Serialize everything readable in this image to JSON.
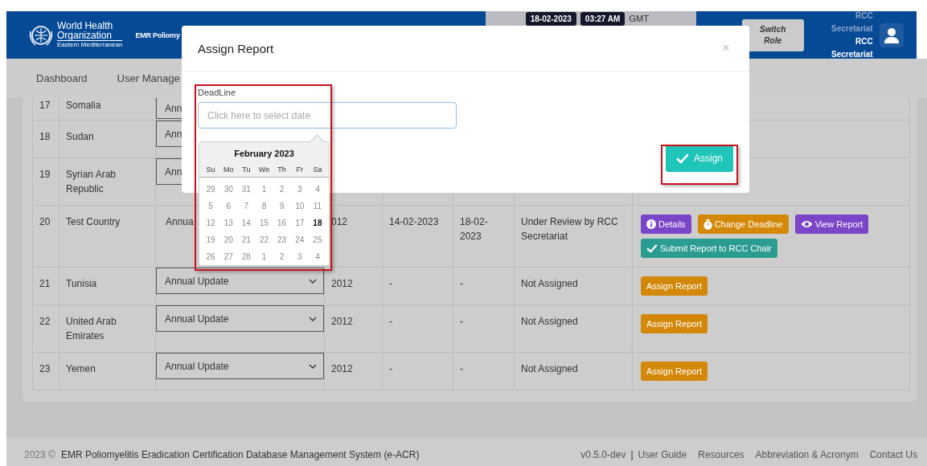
{
  "header": {
    "org_name": "World Health",
    "org_name_2": "Organization",
    "org_region": "Eastern Mediterranean",
    "app_title": "EMR Poliomy",
    "date": "18-02-2023",
    "time": "03:27 AM",
    "timezone": "GMT",
    "switch_role": "Switch Role",
    "user_role_faded": "RCC Secretariat",
    "user_role": "RCC Secretariat"
  },
  "nav": [
    "Dashboard",
    "User Manage"
  ],
  "rows": [
    {
      "no": "17",
      "country": "Somalia",
      "type": {
        "kind": "select",
        "value": "Ann"
      }
    },
    {
      "no": "18",
      "country": "Sudan",
      "type": {
        "kind": "select",
        "value": "Ann"
      }
    },
    {
      "no": "19",
      "country": "Syrian Arab Republic",
      "type": {
        "kind": "select",
        "value": "Ann"
      }
    },
    {
      "no": "20",
      "country": "Test Country",
      "type": {
        "kind": "text",
        "value": "Annua"
      },
      "year": "012",
      "assigned": "14-02-2023",
      "deadline": "18-02-2023",
      "status": "Under Review by RCC Secretariat",
      "actions": [
        {
          "label": "Details",
          "kind": "details"
        },
        {
          "label": "Change Deadline",
          "kind": "deadline"
        },
        {
          "label": "View Report",
          "kind": "view"
        },
        {
          "label": "Submit Report to RCC Chair",
          "kind": "submit"
        }
      ]
    },
    {
      "no": "21",
      "country": "Tunisia",
      "type": {
        "kind": "select",
        "value": "Annual Update"
      },
      "year": "2012",
      "assigned": "-",
      "deadline": "-",
      "status": "Not Assigned",
      "actions": [
        {
          "label": "Assign Report",
          "kind": "assign"
        }
      ]
    },
    {
      "no": "22",
      "country": "United Arab Emirates",
      "type": {
        "kind": "select",
        "value": "Annual Update"
      },
      "year": "2012",
      "assigned": "-",
      "deadline": "-",
      "status": "Not Assigned",
      "actions": [
        {
          "label": "Assign Report",
          "kind": "assign"
        }
      ]
    },
    {
      "no": "23",
      "country": "Yemen",
      "type": {
        "kind": "select",
        "value": "Annual Update"
      },
      "year": "2012",
      "assigned": "-",
      "deadline": "-",
      "status": "Not Assigned",
      "actions": [
        {
          "label": "Assign Report",
          "kind": "assign"
        }
      ]
    }
  ],
  "modal": {
    "title": "Assign Report",
    "close": "×",
    "field_label": "DeadLine",
    "placeholder": "Click here to select date",
    "field_highlighted": true,
    "button": "Assign",
    "button_highlighted": true,
    "datepicker": {
      "month": "February 2023",
      "weekdays": [
        "Su",
        "Mo",
        "Tu",
        "We",
        "Th",
        "Fr",
        "Sa"
      ],
      "weeks": [
        [
          {
            "d": "29",
            "today": false
          },
          {
            "d": "30",
            "today": false
          },
          {
            "d": "31",
            "today": false
          },
          {
            "d": "1",
            "today": false
          },
          {
            "d": "2",
            "today": false
          },
          {
            "d": "3",
            "today": false
          },
          {
            "d": "4",
            "today": false
          }
        ],
        [
          {
            "d": "5",
            "today": false
          },
          {
            "d": "6",
            "today": false
          },
          {
            "d": "7",
            "today": false
          },
          {
            "d": "8",
            "today": false
          },
          {
            "d": "9",
            "today": false
          },
          {
            "d": "10",
            "today": false
          },
          {
            "d": "11",
            "today": false
          }
        ],
        [
          {
            "d": "12",
            "today": false
          },
          {
            "d": "13",
            "today": false
          },
          {
            "d": "14",
            "today": false
          },
          {
            "d": "15",
            "today": false
          },
          {
            "d": "16",
            "today": false
          },
          {
            "d": "17",
            "today": false
          },
          {
            "d": "18",
            "today": true
          }
        ],
        [
          {
            "d": "19",
            "today": false
          },
          {
            "d": "20",
            "today": false
          },
          {
            "d": "21",
            "today": false
          },
          {
            "d": "22",
            "today": false
          },
          {
            "d": "23",
            "today": false
          },
          {
            "d": "24",
            "today": false
          },
          {
            "d": "25",
            "today": false
          }
        ],
        [
          {
            "d": "26",
            "today": false
          },
          {
            "d": "27",
            "today": false
          },
          {
            "d": "28",
            "today": false
          },
          {
            "d": "1",
            "today": false
          },
          {
            "d": "2",
            "today": false
          },
          {
            "d": "3",
            "today": false
          },
          {
            "d": "4",
            "today": false
          }
        ]
      ]
    }
  },
  "footer": {
    "copyright": "2023 ©",
    "system": "EMR Poliomyelitis Eradication Certification Database Management System (e-ACR)",
    "version": "v0.5.0-dev",
    "separator": "|",
    "links": [
      "User Guide",
      "Resources",
      "Abbreviation & Acronym",
      "Contact Us"
    ]
  }
}
